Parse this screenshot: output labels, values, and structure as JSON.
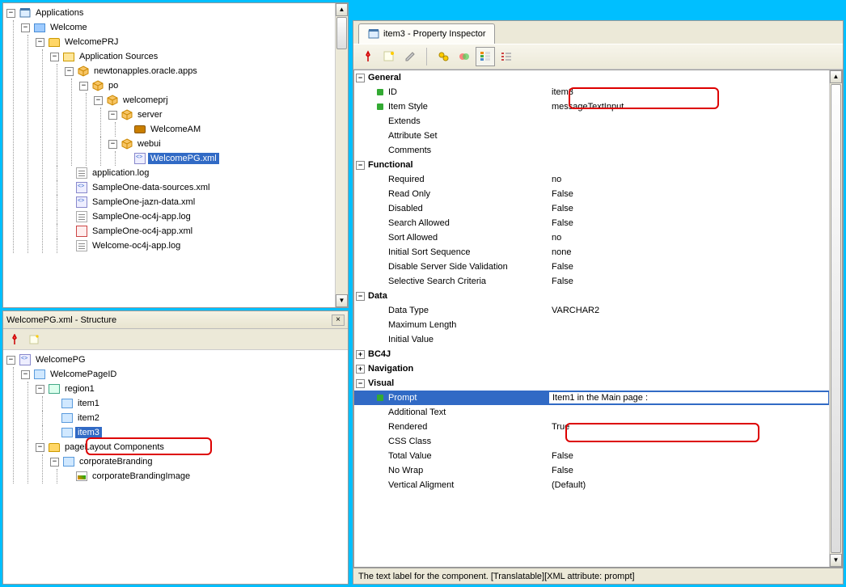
{
  "left_top": {
    "root": "Applications",
    "tree": [
      {
        "label": "Welcome",
        "icon": "ws",
        "children": [
          {
            "label": "WelcomePRJ",
            "icon": "folder",
            "children": [
              {
                "label": "Application Sources",
                "icon": "folder-open",
                "children": [
                  {
                    "label": "newtonapples.oracle.apps",
                    "icon": "package",
                    "children": [
                      {
                        "label": "po",
                        "icon": "package",
                        "children": [
                          {
                            "label": "welcomeprj",
                            "icon": "package",
                            "children": [
                              {
                                "label": "server",
                                "icon": "package",
                                "children": [
                                  {
                                    "label": "WelcomeAM",
                                    "icon": "briefcase"
                                  }
                                ]
                              },
                              {
                                "label": "webui",
                                "icon": "package",
                                "children": [
                                  {
                                    "label": "WelcomePG.xml",
                                    "icon": "xml",
                                    "selected": true
                                  }
                                ]
                              }
                            ]
                          }
                        ]
                      }
                    ]
                  },
                  {
                    "label": "application.log",
                    "icon": "log"
                  },
                  {
                    "label": "SampleOne-data-sources.xml",
                    "icon": "xml"
                  },
                  {
                    "label": "SampleOne-jazn-data.xml",
                    "icon": "xml"
                  },
                  {
                    "label": "SampleOne-oc4j-app.log",
                    "icon": "log"
                  },
                  {
                    "label": "SampleOne-oc4j-app.xml",
                    "icon": "logx"
                  },
                  {
                    "label": "Welcome-oc4j-app.log",
                    "icon": "log"
                  }
                ]
              }
            ]
          }
        ]
      }
    ]
  },
  "left_bot": {
    "title": "WelcomePG.xml - Structure",
    "tree": [
      {
        "label": "WelcomePG",
        "icon": "xml",
        "children": [
          {
            "label": "WelcomePageID",
            "icon": "comp",
            "children": [
              {
                "label": "region1",
                "icon": "region",
                "children": [
                  {
                    "label": "item1",
                    "icon": "comp"
                  },
                  {
                    "label": "item2",
                    "icon": "comp"
                  },
                  {
                    "label": "item3",
                    "icon": "comp",
                    "selected": true
                  }
                ]
              },
              {
                "label": "pageLayout Components",
                "icon": "folder",
                "children": [
                  {
                    "label": "corporateBranding",
                    "icon": "comp",
                    "children": [
                      {
                        "label": "corporateBrandingImage",
                        "icon": "img"
                      }
                    ]
                  }
                ]
              }
            ]
          }
        ]
      }
    ]
  },
  "inspector": {
    "tab_title": "item3 - Property Inspector",
    "status": "The text label for the component. [Translatable][XML attribute: prompt]",
    "groups": [
      {
        "name": "General",
        "expanded": true,
        "rows": [
          {
            "label": "ID",
            "value": "item3",
            "marker": true
          },
          {
            "label": "Item Style",
            "value": "messageTextInput",
            "marker": true,
            "highlight": true
          },
          {
            "label": "Extends",
            "value": ""
          },
          {
            "label": "Attribute Set",
            "value": ""
          },
          {
            "label": "Comments",
            "value": ""
          }
        ]
      },
      {
        "name": "Functional",
        "expanded": true,
        "rows": [
          {
            "label": "Required",
            "value": "no"
          },
          {
            "label": "Read Only",
            "value": "False"
          },
          {
            "label": "Disabled",
            "value": "False"
          },
          {
            "label": "Search Allowed",
            "value": "False"
          },
          {
            "label": "Sort Allowed",
            "value": "no"
          },
          {
            "label": "Initial Sort Sequence",
            "value": "none"
          },
          {
            "label": "Disable Server Side Validation",
            "value": "False"
          },
          {
            "label": "Selective Search Criteria",
            "value": "False"
          }
        ]
      },
      {
        "name": "Data",
        "expanded": true,
        "rows": [
          {
            "label": "Data Type",
            "value": "VARCHAR2"
          },
          {
            "label": "Maximum Length",
            "value": ""
          },
          {
            "label": "Initial Value",
            "value": ""
          }
        ]
      },
      {
        "name": "BC4J",
        "expanded": false,
        "rows": []
      },
      {
        "name": "Navigation",
        "expanded": false,
        "rows": []
      },
      {
        "name": "Visual",
        "expanded": true,
        "rows": [
          {
            "label": "Prompt",
            "value": "Item1 in the Main page :",
            "marker": true,
            "selected": true
          },
          {
            "label": "Additional Text",
            "value": ""
          },
          {
            "label": "Rendered",
            "value": "True"
          },
          {
            "label": "CSS Class",
            "value": ""
          },
          {
            "label": "Total Value",
            "value": "False"
          },
          {
            "label": "No Wrap",
            "value": "False"
          },
          {
            "label": "Vertical Aligment",
            "value": "(Default)"
          }
        ]
      }
    ]
  }
}
